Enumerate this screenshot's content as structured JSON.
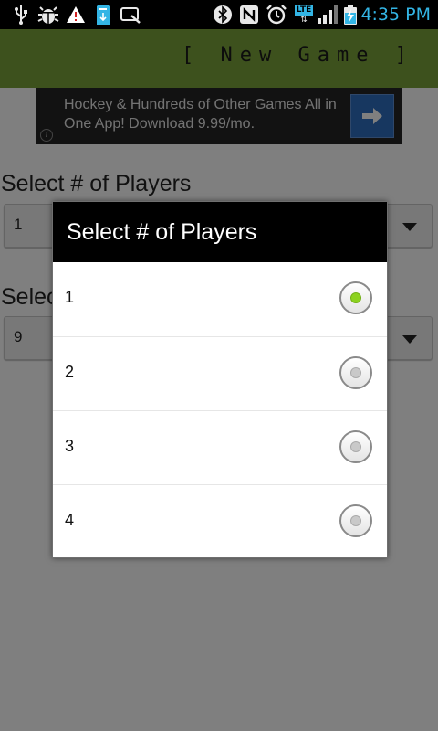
{
  "status_bar": {
    "time": "4:35 PM",
    "network_label": "LTE",
    "icons": [
      "usb-icon",
      "android-debug-icon",
      "warning-icon",
      "sd-card-icon",
      "screenshot-icon",
      "bluetooth-icon",
      "nfc-icon",
      "alarm-icon",
      "lte-icon",
      "signal-icon",
      "battery-charging-icon"
    ]
  },
  "header": {
    "title_button": "[ New Game ]",
    "accent_color": "#7aa33a"
  },
  "ad": {
    "text": "Hockey & Hundreds of Other Games All in One App! Download 9.99/mo.",
    "arrow_icon": "arrow-right-icon",
    "info_icon": "info-icon",
    "arrow_color": "#2f6fc0"
  },
  "form": {
    "players_label": "Select # of Players",
    "players_value": "1",
    "second_label": "Selec",
    "second_value": "9"
  },
  "dialog": {
    "title": "Select # of Players",
    "options": [
      {
        "label": "1",
        "selected": true
      },
      {
        "label": "2",
        "selected": false
      },
      {
        "label": "3",
        "selected": false
      },
      {
        "label": "4",
        "selected": false
      }
    ],
    "selected_color": "#8cd21f"
  }
}
